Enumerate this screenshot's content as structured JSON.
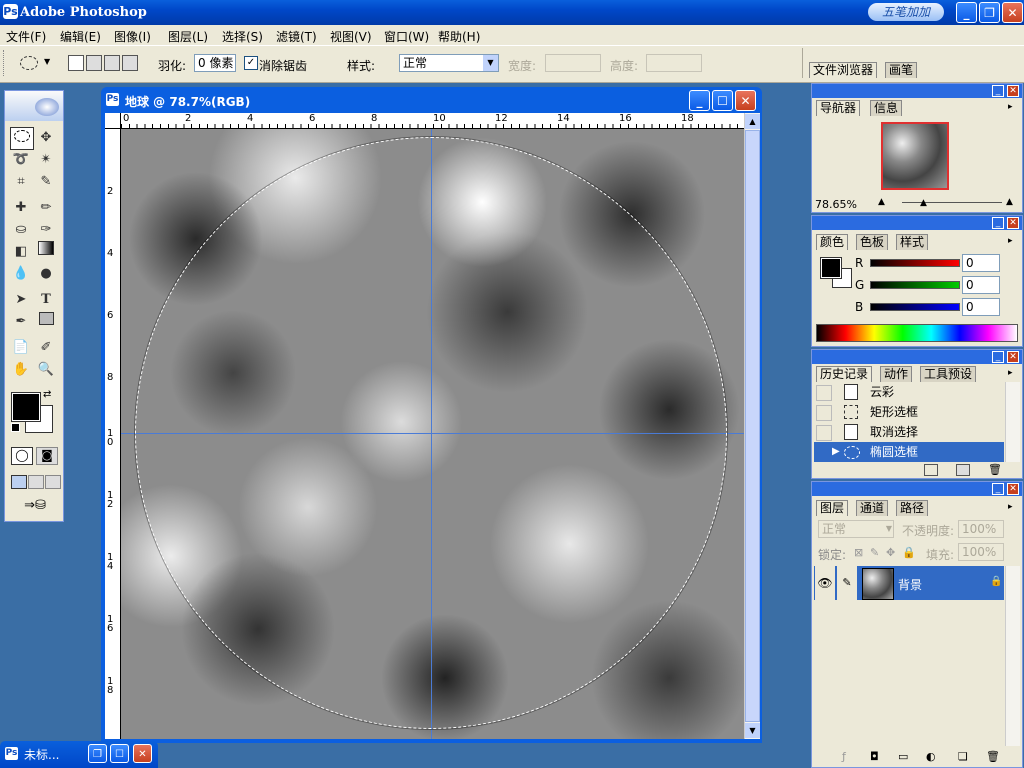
{
  "app": {
    "title": "Adobe Photoshop",
    "badge": "五笔加加"
  },
  "menu": [
    "文件(F)",
    "编辑(E)",
    "图像(I)",
    "图层(L)",
    "选择(S)",
    "滤镜(T)",
    "视图(V)",
    "窗口(W)",
    "帮助(H)"
  ],
  "options": {
    "feather_label": "羽化:",
    "feather_value": "0 像素",
    "antialias_label": "消除锯齿",
    "antialias_checked": true,
    "style_label": "样式:",
    "style_value": "正常",
    "width_label": "宽度:",
    "height_label": "高度:"
  },
  "right_tabs": [
    "文件浏览器",
    "画笔"
  ],
  "document": {
    "title": "地球 @ 78.7%(RGB)",
    "ruler_top": [
      "0",
      "2",
      "4",
      "6",
      "8",
      "10",
      "12",
      "14",
      "16",
      "18"
    ],
    "ruler_left": [
      "2",
      "4",
      "6",
      "8",
      "1 0",
      "1 2",
      "1 4",
      "1 6",
      "1 8"
    ]
  },
  "navigator": {
    "tabs": [
      "导航器",
      "信息"
    ],
    "zoom": "78.65%"
  },
  "color": {
    "tabs": [
      "颜色",
      "色板",
      "样式"
    ],
    "r_label": "R",
    "g_label": "G",
    "b_label": "B",
    "r": "0",
    "g": "0",
    "b": "0"
  },
  "history": {
    "tabs": [
      "历史记录",
      "动作",
      "工具预设"
    ],
    "items": [
      {
        "label": "云彩",
        "icon": "document-icon"
      },
      {
        "label": "矩形选框",
        "icon": "rect-marquee-icon"
      },
      {
        "label": "取消选择",
        "icon": "document-icon"
      },
      {
        "label": "椭圆选框",
        "icon": "ellipse-marquee-icon",
        "selected": true
      }
    ]
  },
  "layers": {
    "tabs": [
      "图层",
      "通道",
      "路径"
    ],
    "blend_mode": "正常",
    "opacity_label": "不透明度:",
    "opacity": "100%",
    "lock_label": "锁定:",
    "fill_label": "填充:",
    "fill": "100%",
    "layer_name": "背景"
  },
  "taskbar": {
    "minimized_title": "未标..."
  },
  "colors": {
    "title_blue": "#0b5fe0",
    "panel_bg": "#ece9d8",
    "selection_blue": "#316ac5",
    "guide_blue": "#4a7bd6"
  }
}
